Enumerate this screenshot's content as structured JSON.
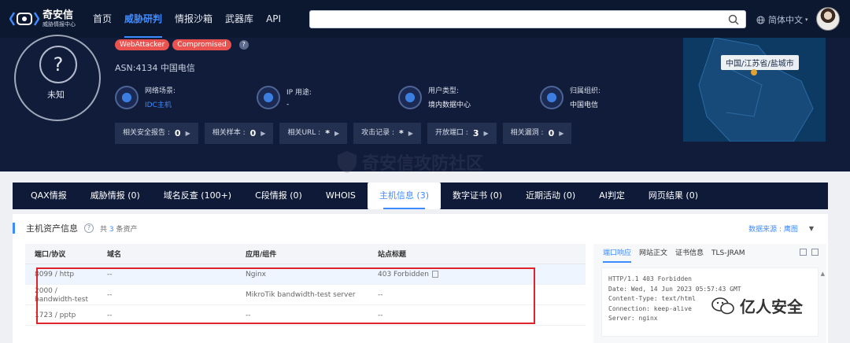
{
  "topbar": {
    "logo_main": "奇安信",
    "logo_sub": "威胁情报中心",
    "nav": [
      {
        "label": "首页",
        "active": false
      },
      {
        "label": "威胁研判",
        "active": true
      },
      {
        "label": "情报沙箱",
        "active": false
      },
      {
        "label": "武器库",
        "active": false
      },
      {
        "label": "API",
        "active": false
      }
    ],
    "search_placeholder": "",
    "language": "简体中文"
  },
  "hero": {
    "badge_text": "未知",
    "tags": [
      "WebAttacker",
      "Compromised"
    ],
    "asn": "ASN:4134 中国电信",
    "info": [
      {
        "label": "网络场景:",
        "value": "IDC主机",
        "link": true
      },
      {
        "label": "IP 用途:",
        "value": "-",
        "link": false
      },
      {
        "label": "用户类型:",
        "value": "境内数据中心",
        "link": false
      },
      {
        "label": "归属组织:",
        "value": "中国电信",
        "link": false
      }
    ],
    "stats": [
      {
        "label": "相关安全报告 :",
        "value": "0"
      },
      {
        "label": "相关样本 :",
        "value": "0"
      },
      {
        "label": "相关URL :",
        "value": "*"
      },
      {
        "label": "攻击记录 :",
        "value": "*"
      },
      {
        "label": "开放端口 :",
        "value": "3"
      },
      {
        "label": "相关漏洞 :",
        "value": "0"
      }
    ],
    "map_location": "中国/江苏省/盐城市"
  },
  "watermark": "奇安信攻防社区",
  "tabs": [
    {
      "label": "QAX情报",
      "active": false
    },
    {
      "label": "威胁情报 (0)",
      "active": false
    },
    {
      "label": "域名反查 (100+)",
      "active": false
    },
    {
      "label": "C段情报 (0)",
      "active": false
    },
    {
      "label": "WHOIS",
      "active": false
    },
    {
      "label": "主机信息 (3)",
      "active": true
    },
    {
      "label": "数字证书 (0)",
      "active": false
    },
    {
      "label": "近期活动 (0)",
      "active": false
    },
    {
      "label": "AI判定",
      "active": false
    },
    {
      "label": "网页结果 (0)",
      "active": false
    }
  ],
  "panel": {
    "title": "主机资产信息",
    "count_prefix": "共",
    "count": "3",
    "count_suffix": "条资产",
    "source_label": "数据来源 : 鹰图",
    "columns": [
      "端口/协议",
      "域名",
      "应用/组件",
      "站点标题"
    ],
    "rows": [
      [
        "8099 / http",
        "--",
        "Nginx",
        "403 Forbidden"
      ],
      [
        "2000 / bandwidth-test",
        "--",
        "MikroTik bandwidth-test server",
        "--"
      ],
      [
        "1723 / pptp",
        "--",
        "--",
        "--"
      ]
    ]
  },
  "side": {
    "tabs": [
      {
        "label": "端口响应",
        "active": true
      },
      {
        "label": "网站正文",
        "active": false
      },
      {
        "label": "证书信息",
        "active": false
      },
      {
        "label": "TLS-JRAM",
        "active": false
      }
    ],
    "response": "HTTP/1.1 403 Forbidden\nDate: Wed, 14 Jun 2023 05:57:43 GMT\nContent-Type: text/html\nConnection: keep-alive\nServer: nginx"
  },
  "footer_brand": "亿人安全",
  "colors": {
    "accent": "#3e8bff",
    "nav_bg": "#0c1730",
    "hero_bg": "#111c3a",
    "tag_red": "#e9524e",
    "highlight": "#e0222a"
  }
}
